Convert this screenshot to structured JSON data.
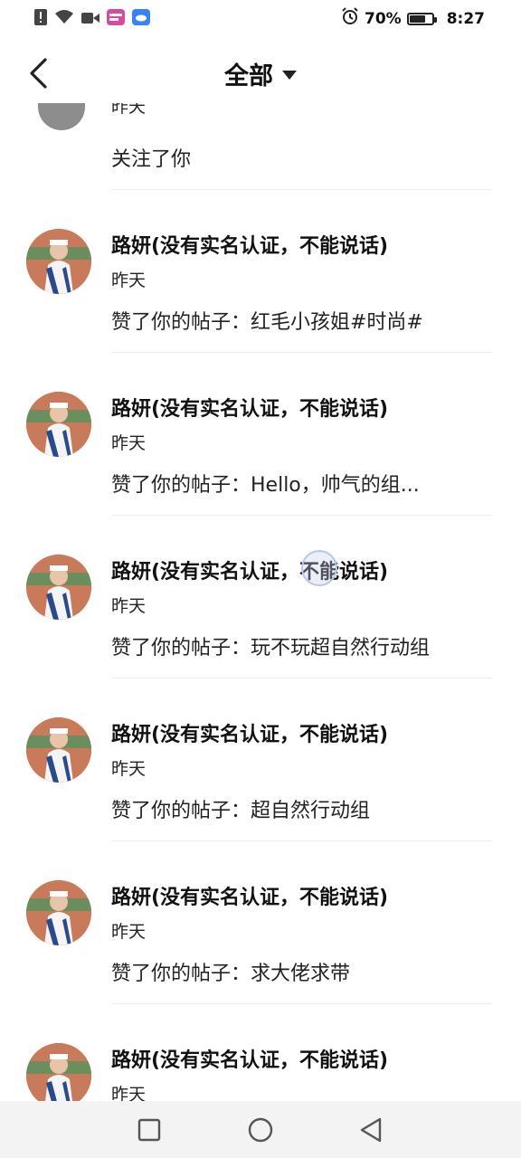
{
  "status_bar": {
    "battery_percent_text": "70%",
    "battery_level": 0.7,
    "time": "8:27",
    "left_icons": [
      "alert-icon",
      "wifi-icon",
      "video-icon",
      "app-badge-icon",
      "cloud-app-icon"
    ],
    "right_icons": [
      "alarm-icon",
      "battery-icon"
    ]
  },
  "header": {
    "back_icon": "back-arrow-icon",
    "title": "全部",
    "dropdown_icon": "caret-down-icon"
  },
  "partial_item": {
    "time": "昨天",
    "message": "关注了你"
  },
  "notifications": [
    {
      "name": "路妍(没有实名认证，不能说话)",
      "time": "昨天",
      "message": "赞了你的帖子：红毛小孩姐#时尚#"
    },
    {
      "name": "路妍(没有实名认证，不能说话)",
      "time": "昨天",
      "message": "赞了你的帖子：Hello，帅气的组..."
    },
    {
      "name": "路妍(没有实名认证，不能说话)",
      "time": "昨天",
      "message": "赞了你的帖子：玩不玩超自然行动组"
    },
    {
      "name": "路妍(没有实名认证，不能说话)",
      "time": "昨天",
      "message": "赞了你的帖子：超自然行动组"
    },
    {
      "name": "路妍(没有实名认证，不能说话)",
      "time": "昨天",
      "message": "赞了你的帖子：求大佬求带"
    },
    {
      "name": "路妍(没有实名认证，不能说话)",
      "time": "昨天",
      "message": ""
    }
  ],
  "nav_bar": {
    "buttons": [
      "recents-square-icon",
      "home-circle-icon",
      "back-triangle-icon"
    ]
  },
  "colors": {
    "background": "#ffffff",
    "text": "#111111",
    "divider": "#eeeeee",
    "nav_background": "#f3f3f3"
  }
}
